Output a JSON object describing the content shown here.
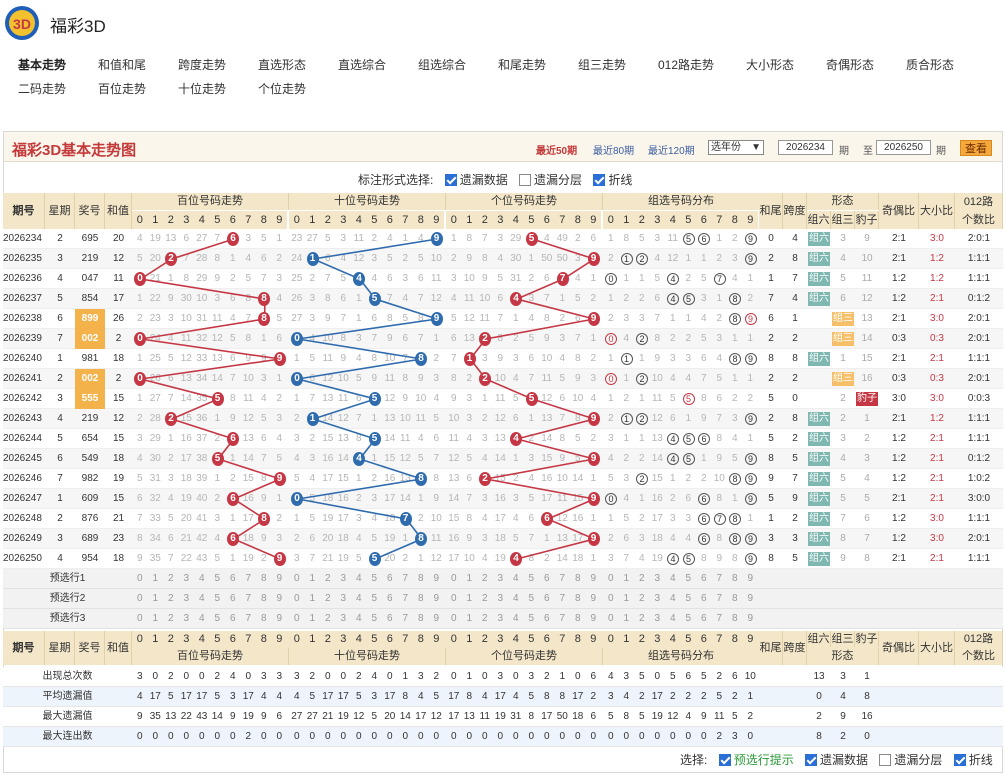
{
  "app": {
    "title": "福彩3D",
    "logo": "fucai-logo"
  },
  "nav": [
    {
      "label": "基本走势",
      "active": true
    },
    {
      "label": "和值和尾"
    },
    {
      "label": "跨度走势"
    },
    {
      "label": "直选形态"
    },
    {
      "label": "直选综合"
    },
    {
      "label": "组选综合"
    },
    {
      "label": "和尾走势"
    },
    {
      "label": "组三走势"
    },
    {
      "label": "012路走势"
    },
    {
      "label": "大小形态"
    },
    {
      "label": "奇偶形态"
    },
    {
      "label": "质合形态"
    },
    {
      "label": "二码走势"
    },
    {
      "label": "百位走势"
    },
    {
      "label": "十位走势"
    },
    {
      "label": "个位走势"
    }
  ],
  "panel": {
    "title": "福彩3D基本走势图",
    "periods": [
      {
        "label": "最近50期",
        "active": true
      },
      {
        "label": "最近80期"
      },
      {
        "label": "最近120期"
      }
    ],
    "year_select": "选年份",
    "from": "2026234",
    "from_unit": "期",
    "to_label": "至",
    "to": "2026250",
    "to_unit": "期",
    "query": "查看"
  },
  "mark_options": {
    "label": "标注形式选择:",
    "items": [
      {
        "label": "遗漏数据",
        "checked": true
      },
      {
        "label": "遗漏分层",
        "checked": false
      },
      {
        "label": "折线",
        "checked": true
      }
    ]
  },
  "headers": {
    "period": "期号",
    "week": "星期",
    "number": "奖号",
    "sum": "和值",
    "hundreds": "百位号码走势",
    "tens": "十位号码走势",
    "units": "个位号码走势",
    "group": "组选号码分布",
    "tail": "和尾",
    "span": "跨度",
    "shape": "形态",
    "g6": "组六",
    "g3": "组三",
    "bz": "豹子",
    "oe": "奇偶比",
    "bs": "大小比",
    "r012a": "012路",
    "r012b": "个数比",
    "digits": [
      "0",
      "1",
      "2",
      "3",
      "4",
      "5",
      "6",
      "7",
      "8",
      "9"
    ],
    "shape2": "组三 豹子"
  },
  "rows": [
    {
      "p": "2026234",
      "w": "2",
      "n": "695",
      "s": "20",
      "t": "0",
      "sp": "4",
      "oe": "2:1",
      "bs": "3:0",
      "r": "2:0:1",
      "h": "4 19 13 6 27 7 6 3 5 1",
      "te": "23 27 5 3 11 2 4 1 4 9",
      "u": "1 8 7 3 29 5 4 49 2 6",
      "g": "1 8 5 3 11 5 6 1 2 9",
      "gs": "g6",
      "g3m": "3",
      "bzm": "9"
    },
    {
      "p": "2026235",
      "w": "3",
      "n": "219",
      "s": "12",
      "t": "2",
      "sp": "8",
      "oe": "2:1",
      "bs": "1:2",
      "r": "1:1:1",
      "h": "5 20 2 7 28 8 1 4 6 2",
      "te": "24 1 6 4 12 3 5 2 5 10",
      "u": "2 9 8 4 30 1 50 50 3 9",
      "g": "2 1 2 4 12 1 1 2 3 9",
      "gs": "g6",
      "g3m": "4",
      "bzm": "10"
    },
    {
      "p": "2026236",
      "w": "4",
      "n": "047",
      "s": "11",
      "t": "1",
      "sp": "7",
      "oe": "1:2",
      "bs": "1:2",
      "r": "1:1:1",
      "h": "0 21 1 8 29 9 2 5 7 3",
      "te": "25 2 7 5 4 4 6 3 6 11",
      "u": "3 10 9 5 31 2 6 7 4 1",
      "g": "0 1 1 5 4 2 5 7 4 1",
      "gs": "g6",
      "g3m": "5",
      "bzm": "11"
    },
    {
      "p": "2026237",
      "w": "5",
      "n": "854",
      "s": "17",
      "t": "7",
      "sp": "4",
      "oe": "1:2",
      "bs": "2:1",
      "r": "0:1:2",
      "h": "1 22 9 30 10 3 6 8 8 4",
      "te": "26 3 8 6 1 5 7 4 7 12",
      "u": "4 11 10 6 4 3 7 1 5 2",
      "g": "1 2 2 6 4 5 3 1 8 2",
      "gs": "g6",
      "g3m": "6",
      "bzm": "12"
    },
    {
      "p": "2026238",
      "w": "6",
      "n": "899",
      "s": "26",
      "t": "6",
      "sp": "1",
      "oe": "2:1",
      "bs": "3:0",
      "r": "2:0:1",
      "h": "2 23 3 10 31 11 4 7 8 5",
      "te": "27 3 9 7 1 6 8 5 8 9",
      "u": "5 12 11 7 1 4 8 2 6 9",
      "g": "2 3 3 7 1 1 4 2 8 9",
      "gs": "g3",
      "g3m": "组三",
      "bzm": "13",
      "hl": true
    },
    {
      "p": "2026239",
      "w": "7",
      "n": "002",
      "s": "2",
      "t": "2",
      "sp": "2",
      "oe": "0:3",
      "bs": "0:3",
      "r": "2:0:1",
      "h": "0 24 4 11 32 12 5 8 1 6",
      "te": "0 4 10 8 3 7 9 6 7 1",
      "u": "6 13 2 8 2 5 9 3 7 1",
      "g": "0 4 2 8 2 2 5 3 1 1",
      "gs": "g3",
      "g3m": "组三",
      "bzm": "14",
      "hl": true
    },
    {
      "p": "2026240",
      "w": "1",
      "n": "981",
      "s": "18",
      "t": "8",
      "sp": "8",
      "oe": "2:1",
      "bs": "2:1",
      "r": "1:1:1",
      "h": "1 25 5 12 33 13 6 9 9 9",
      "te": "1 5 11 9 4 8 10 7 8 2",
      "u": "7 1 3 9 3 6 10 4 8 2",
      "g": "1 1 1 9 3 3 6 4 8 9",
      "gs": "g6",
      "g3m": "1",
      "bzm": "15"
    },
    {
      "p": "2026241",
      "w": "2",
      "n": "002",
      "s": "2",
      "t": "2",
      "sp": "2",
      "oe": "0:3",
      "bs": "0:3",
      "r": "2:0:1",
      "h": "0 26 6 13 34 14 7 10 3 1",
      "te": "0 6 12 10 5 9 11 8 9 3",
      "u": "8 2 2 10 4 7 11 5 9 3",
      "g": "0 1 2 10 4 4 7 5 1 1",
      "gs": "g3",
      "g3m": "组三",
      "bzm": "16",
      "hl": true
    },
    {
      "p": "2026242",
      "w": "3",
      "n": "555",
      "s": "15",
      "t": "5",
      "sp": "0",
      "oe": "3:0",
      "bs": "3:0",
      "r": "0:0:3",
      "h": "1 27 7 14 35 5 8 11 4 2",
      "te": "1 7 13 11 6 5 12 9 10 4",
      "u": "9 3 1 11 5 5 12 6 10 4",
      "g": "1 2 1 11 5 5 8 6 2 2",
      "gs": "bz",
      "g3m": "2",
      "bzm": "豹子",
      "hl": true
    },
    {
      "p": "2026243",
      "w": "4",
      "n": "219",
      "s": "12",
      "t": "2",
      "sp": "8",
      "oe": "2:1",
      "bs": "1:2",
      "r": "1:1:1",
      "h": "2 28 2 15 36 1 9 12 5 3",
      "te": "2 1 14 12 7 1 13 10 11 5",
      "u": "10 3 2 12 6 1 13 7 8 9",
      "g": "2 1 2 12 6 1 9 7 3 9",
      "gs": "g6",
      "g3m": "2",
      "bzm": "1"
    },
    {
      "p": "2026244",
      "w": "5",
      "n": "654",
      "s": "15",
      "t": "5",
      "sp": "2",
      "oe": "1:2",
      "bs": "2:1",
      "r": "1:1:1",
      "h": "3 29 1 16 37 2 6 13 6 4",
      "te": "3 2 15 13 8 5 14 11 4 6",
      "u": "11 4 3 13 4 2 14 8 5 2",
      "g": "3 1 1 13 4 5 6 8 4 1",
      "gs": "g6",
      "g3m": "3",
      "bzm": "2"
    },
    {
      "p": "2026245",
      "w": "6",
      "n": "549",
      "s": "18",
      "t": "8",
      "sp": "5",
      "oe": "1:2",
      "bs": "2:1",
      "r": "0:1:2",
      "h": "4 30 2 17 38 5 1 14 7 5",
      "te": "4 3 16 14 4 1 15 12 5 7",
      "u": "12 5 4 14 1 3 15 9 5 9",
      "g": "4 2 2 14 4 5 1 9 5 9",
      "gs": "g6",
      "g3m": "4",
      "bzm": "3"
    },
    {
      "p": "2026246",
      "w": "7",
      "n": "982",
      "s": "19",
      "t": "9",
      "sp": "7",
      "oe": "1:2",
      "bs": "2:1",
      "r": "1:0:2",
      "h": "5 31 3 18 39 1 2 15 8 9",
      "te": "5 4 17 15 1 2 16 13 8 8",
      "u": "13 6 2 15 2 4 16 10 14 1",
      "g": "5 3 2 15 1 2 2 10 8 9",
      "gs": "g6",
      "g3m": "5",
      "bzm": "4"
    },
    {
      "p": "2026247",
      "w": "1",
      "n": "609",
      "s": "15",
      "t": "5",
      "sp": "9",
      "oe": "2:1",
      "bs": "2:1",
      "r": "3:0:0",
      "h": "6 32 4 19 40 2 6 16 9 1",
      "te": "0 5 18 16 2 3 17 14 1 9",
      "u": "14 7 3 16 3 5 17 11 15 9",
      "g": "0 4 1 16 2 6 2 8 1 9",
      "gs": "g6",
      "g3m": "5",
      "bzm": "5"
    },
    {
      "p": "2026248",
      "w": "2",
      "n": "876",
      "s": "21",
      "t": "1",
      "sp": "2",
      "oe": "1:2",
      "bs": "3:0",
      "r": "1:1:1",
      "h": "7 33 5 20 41 3 1 17 8 2",
      "te": "1 5 19 17 3 4 18 7 2 10",
      "u": "15 8 4 17 4 6 6 12 16 1",
      "g": "1 5 2 17 3 3 6 7 8 1",
      "gs": "g6",
      "g3m": "7",
      "bzm": "6"
    },
    {
      "p": "2026249",
      "w": "3",
      "n": "689",
      "s": "23",
      "t": "3",
      "sp": "3",
      "oe": "1:2",
      "bs": "3:0",
      "r": "2:0:1",
      "h": "8 34 6 21 42 4 6 18 9 3",
      "te": "2 6 20 18 4 5 19 1 8 11",
      "u": "16 9 3 18 5 7 1 13 17 9",
      "g": "2 6 3 18 4 4 6 8 8 9",
      "gs": "g6",
      "g3m": "8",
      "bzm": "7"
    },
    {
      "p": "2026250",
      "w": "4",
      "n": "954",
      "s": "18",
      "t": "8",
      "sp": "5",
      "oe": "2:1",
      "bs": "2:1",
      "r": "1:1:1",
      "h": "9 35 7 22 43 5 1 19 2 9",
      "te": "3 7 21 19 5 5 20 2 1 12",
      "u": "17 10 4 19 4 8 2 14 18 1",
      "g": "3 7 4 19 4 5 8 9 8 9",
      "gs": "g6",
      "g3m": "9",
      "bzm": "8"
    }
  ],
  "pre": [
    {
      "label": "预选行1"
    },
    {
      "label": "预选行2"
    },
    {
      "label": "预选行3"
    }
  ],
  "stats": [
    {
      "label": "出现总次数",
      "v": "3 0 2 0 0 2 4 0 3 3 | 3 2 0 0 2 4 0 1 3 2 | 0 1 0 3 0 3 2 1 0 6 | 4 3 5 0 5 6 5 2 6 10",
      "e": "13 3 1"
    },
    {
      "label": "平均遗漏值",
      "v": "4 17 5 17 17 5 3 17 4 4 | 4 5 17 17 5 3 17 8 4 5 | 17 8 4 17 4 5 8 8 17 2 | 3 4 2 17 2 2 2 5 2 1",
      "e": "0 4 8"
    },
    {
      "label": "最大遗漏值",
      "v": "9 35 13 22 43 14 9 19 9 6 | 27 27 21 19 12 5 20 14 17 12 | 17 13 11 19 31 8 17 50 18 6 | 5 8 5 19 12 4 9 11 5 2",
      "e": "2 9 16"
    },
    {
      "label": "最大连出数",
      "v": "0 0 0 0 0 0 0 2 0 0 | 0 0 0 0 0 0 0 0 0 0 | 0 0 0 0 0 0 0 0 0 0 | 0 0 0 0 0 0 0 2 3 0",
      "e": "8 2 0"
    }
  ],
  "footer": {
    "label": "选择:",
    "items": [
      {
        "label": "预选行提示",
        "checked": true,
        "green": true
      },
      {
        "label": "遗漏数据",
        "checked": true
      },
      {
        "label": "遗漏分层",
        "checked": false
      },
      {
        "label": "折线",
        "checked": true
      }
    ]
  },
  "colors": {
    "red": "#c53744",
    "blue": "#2f6cae",
    "header": "#f4e7c9",
    "title": "#c4393a",
    "g6": "#7fb8b0",
    "g3": "#f6c06b",
    "bz": "#c53744"
  }
}
